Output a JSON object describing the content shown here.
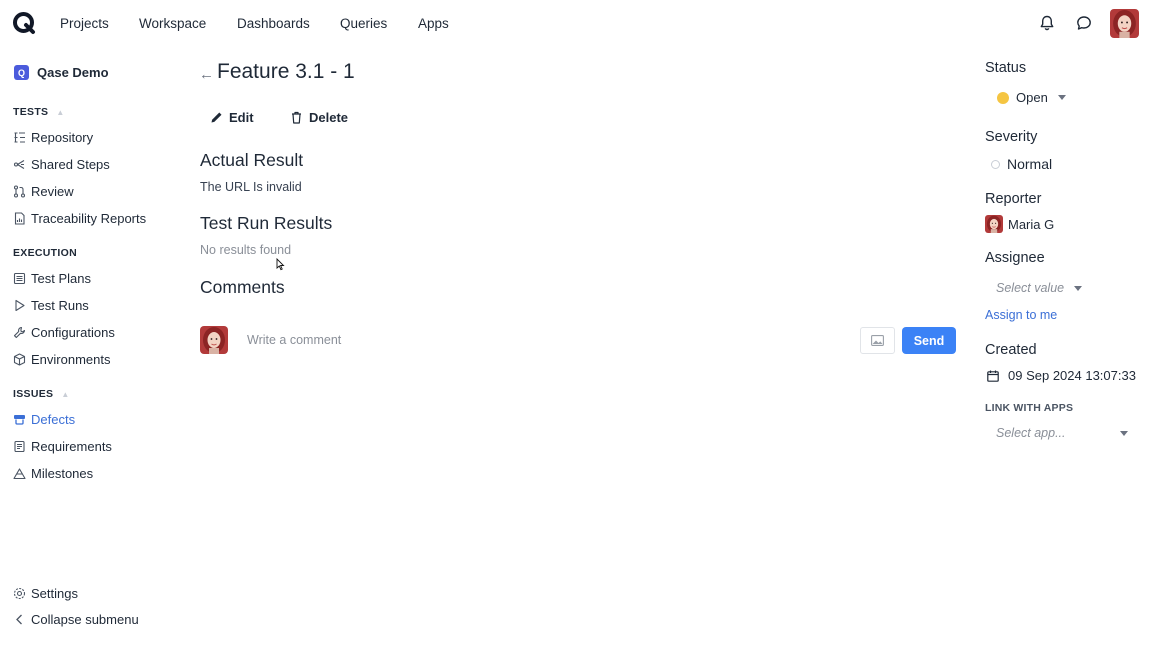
{
  "topnav": {
    "items": [
      "Projects",
      "Workspace",
      "Dashboards",
      "Queries",
      "Apps"
    ],
    "icons": [
      "bell-icon",
      "chat-icon"
    ]
  },
  "sidebar": {
    "project_name": "Qase Demo",
    "project_badge": "Q",
    "sections": {
      "tests": "TESTS",
      "execution": "EXECUTION",
      "issues": "ISSUES"
    },
    "tests_items": [
      "Repository",
      "Shared Steps",
      "Review",
      "Traceability Reports"
    ],
    "execution_items": [
      "Test Plans",
      "Test Runs",
      "Configurations",
      "Environments"
    ],
    "issues_items": [
      "Defects",
      "Requirements",
      "Milestones"
    ],
    "footer": {
      "settings": "Settings",
      "collapse": "Collapse submenu"
    },
    "active_color": "#3b6fd6"
  },
  "main": {
    "back": "←",
    "title": "Feature 3.1 - 1",
    "actions": {
      "edit": "Edit",
      "delete": "Delete"
    },
    "actual_result": {
      "heading": "Actual Result",
      "text": "The URL Is invalid"
    },
    "test_run_results": {
      "heading": "Test Run Results",
      "text": "No results found"
    },
    "comments": {
      "heading": "Comments",
      "placeholder": "Write a comment",
      "send": "Send"
    }
  },
  "details": {
    "status": {
      "label": "Status",
      "value": "Open",
      "color": "#f5c542"
    },
    "severity": {
      "label": "Severity",
      "value": "Normal"
    },
    "reporter": {
      "label": "Reporter",
      "value": "Maria G"
    },
    "assignee": {
      "label": "Assignee",
      "placeholder": "Select value",
      "assign_link": "Assign to me"
    },
    "created": {
      "label": "Created",
      "value": "09 Sep 2024 13:07:33"
    },
    "link_apps": {
      "label": "LINK WITH APPS",
      "placeholder": "Select app..."
    }
  },
  "colors": {
    "accent": "#3b82f6",
    "brand": "#4b5bdc"
  }
}
